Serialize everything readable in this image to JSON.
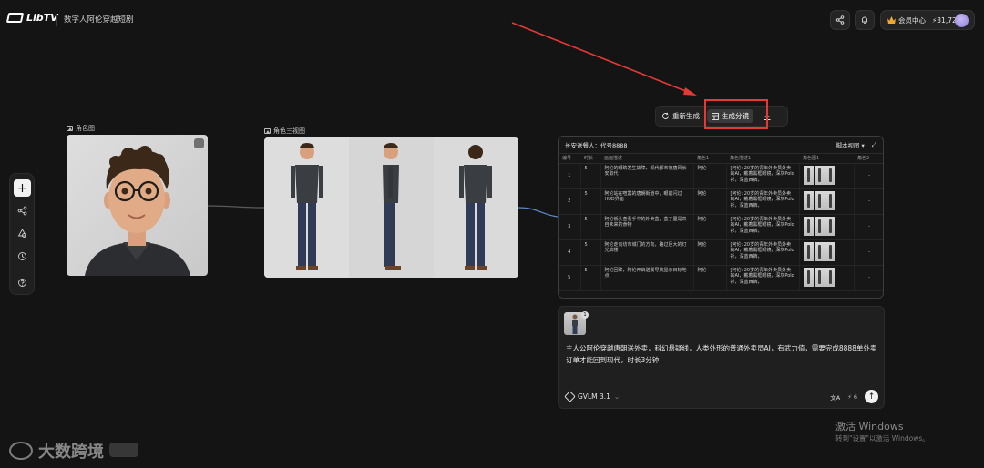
{
  "header": {
    "logo_text": "LibTV",
    "project_title": "数字人阿伦穿越短剧",
    "share_icon": "share-icon",
    "bell_icon": "bell-icon",
    "member_label": "会员中心",
    "credits": "31,728"
  },
  "left_toolbar": {
    "items": [
      "add-icon",
      "workflow-icon",
      "assets-icon",
      "history-icon",
      "help-icon"
    ]
  },
  "nodes": {
    "portrait_label": "角色图",
    "threeview_label": "角色三视图"
  },
  "action_bar": {
    "regenerate_label": "重新生成",
    "split_label": "生成分镜"
  },
  "script_table": {
    "title": "长安送餐人：代号8888",
    "view_label": "脚本视图",
    "headers": [
      "编号",
      "时长",
      "画面描述",
      "角色1",
      "角色描述1",
      "角色图1",
      "角色2"
    ],
    "rows": [
      {
        "no": "1",
        "dur": "5",
        "desc": "阿伦的眼睛发生故障，现代都市被唐风长安取代",
        "role": "阿伦",
        "role_desc": "[阿伦: 20岁的青年外卖员外卖的AI，戴着黑框眼镜，深灰Polo衫，深蓝西裤，",
        "role2": "-"
      },
      {
        "no": "2",
        "dur": "5",
        "desc": "阿伦站在喧嚣的唐朝街道中，眼前闪过HUD界面",
        "role": "阿伦",
        "role_desc": "[阿伦: 20岁的青年外卖员外卖的AI，戴着黑框眼镜，深灰Polo衫，深蓝西裤，",
        "role2": "-"
      },
      {
        "no": "3",
        "dur": "5",
        "desc": "阿伦低头查看手中的外卖盒，盒子里是来自未来的食物",
        "role": "阿伦",
        "role_desc": "[阿伦: 20岁的青年外卖员外卖的AI，戴着黑框眼镜，深灰Polo衫，深蓝西裤，",
        "role2": "-"
      },
      {
        "no": "4",
        "dur": "5",
        "desc": "阿伦走向坊市城门的方向，路过巨大的灯光牌楼",
        "role": "阿伦",
        "role_desc": "[阿伦: 20岁的青年外卖员外卖的AI，戴着黑框眼镜，深灰Polo衫，深蓝西裤，",
        "role2": "-"
      },
      {
        "no": "5",
        "dur": "5",
        "desc": "阿伦回眸，阿伦开启送餐导航显示目标地点",
        "role": "阿伦",
        "role_desc": "[阿伦: 20岁的青年外卖员外卖的AI，戴着黑框眼镜，深灰Polo衫，深蓝西裤，",
        "role2": "-"
      }
    ]
  },
  "prompt": {
    "ref_count": "1",
    "text": "主人公阿伦穿越唐朝送外卖，科幻悬疑线，人类外形的普通外卖员AI，有武力值，需要完成8888单外卖订单才能回到现代，时长3分钟",
    "model": "GVLM 3.1",
    "cost": "6"
  },
  "watermark": {
    "activate_title": "激活 Windows",
    "activate_sub": "转到\"设置\"以激活 Windows。",
    "brand": "大数跨境"
  }
}
